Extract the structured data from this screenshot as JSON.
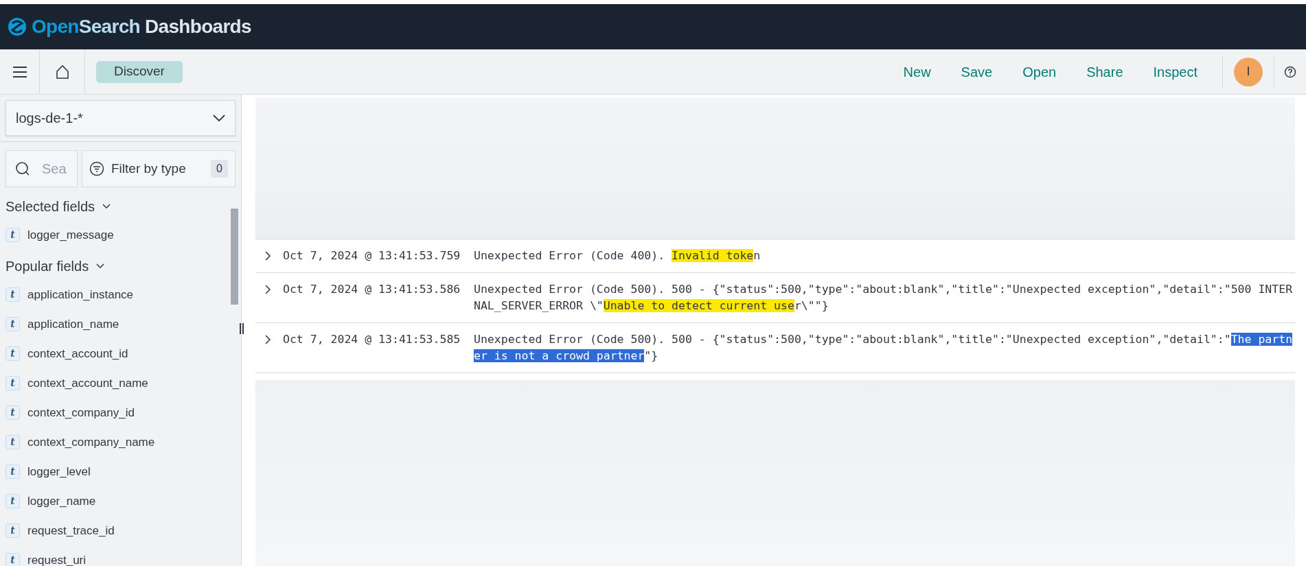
{
  "header": {
    "brand": {
      "part_1": "Open",
      "part_2": "Search",
      "part_3": "Dashboards"
    }
  },
  "toolbar": {
    "breadcrumb": "Discover",
    "actions": [
      "New",
      "Save",
      "Open",
      "Share",
      "Inspect"
    ],
    "avatar": "I"
  },
  "sidebar": {
    "index_pattern": "logs-de-1-*",
    "search": {
      "placeholder": "Sea"
    },
    "filter": {
      "label": "Filter by type",
      "count": "0"
    },
    "sections": [
      {
        "title": "Selected fields",
        "expanded": true,
        "fields": [
          {
            "type": "t",
            "name": "logger_message"
          }
        ]
      },
      {
        "title": "Popular fields",
        "expanded": true,
        "fields": [
          {
            "type": "t",
            "name": "application_instance"
          },
          {
            "type": "t",
            "name": "application_name"
          },
          {
            "type": "t",
            "name": "context_account_id"
          },
          {
            "type": "t",
            "name": "context_account_name"
          },
          {
            "type": "t",
            "name": "context_company_id"
          },
          {
            "type": "t",
            "name": "context_company_name"
          },
          {
            "type": "t",
            "name": "logger_level"
          },
          {
            "type": "t",
            "name": "logger_name"
          },
          {
            "type": "t",
            "name": "request_trace_id"
          },
          {
            "type": "t",
            "name": "request_uri"
          }
        ]
      }
    ]
  },
  "documents": [
    {
      "expanded": false,
      "time": "Oct 7, 2024 @ 13:41:53.759",
      "message": [
        {
          "kind": "plain",
          "text": "Unexpected Error (Code 400). "
        },
        {
          "kind": "marker",
          "text": "Invalid toke"
        },
        {
          "kind": "plain",
          "text": "n"
        }
      ]
    },
    {
      "expanded": false,
      "time": "Oct 7, 2024 @ 13:41:53.586",
      "message": [
        {
          "kind": "plain",
          "text": "Unexpected Error (Code 500). 500 - {\"status\":500,\"type\":\"about:blank\",\"title\":\"Unexpected exception\",\"detail\":\"500 INTERNAL_SERVER_ERROR \\\""
        },
        {
          "kind": "marker",
          "text": "Unable to detect current use"
        },
        {
          "kind": "plain",
          "text": "r\\\"\"}"
        }
      ]
    },
    {
      "expanded": false,
      "time": "Oct 7, 2024 @ 13:41:53.585",
      "message": [
        {
          "kind": "plain",
          "text": "Unexpected Error (Code 500). 500 - {\"status\":500,\"type\":\"about:blank\",\"title\":\"Unexpected exception\",\"detail\":\""
        },
        {
          "kind": "selection",
          "text": "The partner is not a crowd partner"
        },
        {
          "kind": "plain",
          "text": "\"}"
        }
      ]
    }
  ]
}
